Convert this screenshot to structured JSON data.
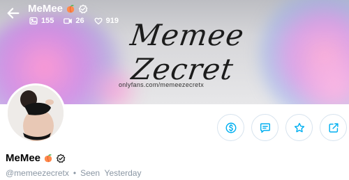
{
  "header": {
    "title": "MeMee",
    "stats": {
      "photos": "155",
      "videos": "26",
      "likes": "919"
    }
  },
  "banner": {
    "signature": "Memee Zecret",
    "url": "onlyfans.com/memeezecretx"
  },
  "profile": {
    "name": "MeMee",
    "handle": "@memeezecretx",
    "separator": "•",
    "status": "Seen  Yesterday"
  },
  "colors": {
    "accent": "#00aff0",
    "muted": "#8a96a3"
  },
  "icons": {
    "back": "arrow-left-icon",
    "photos": "image-icon",
    "videos": "video-icon",
    "likes": "heart-icon",
    "tip": "dollar-icon",
    "message": "message-icon",
    "favorite": "star-icon",
    "share": "share-icon",
    "emoji": "peach-icon",
    "badge": "verified-badge-icon"
  }
}
